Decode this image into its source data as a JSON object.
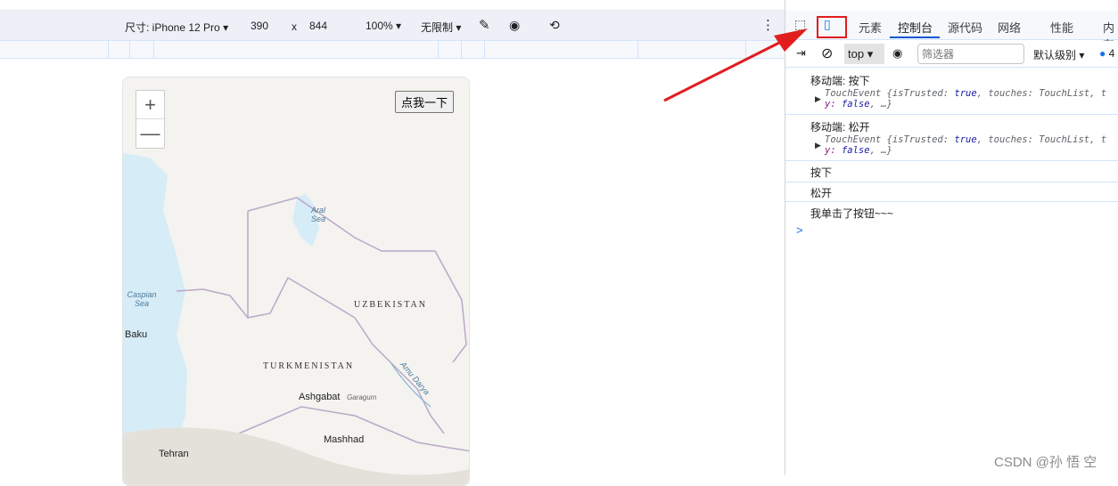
{
  "device_toolbar": {
    "dimensions_label": "尺寸: iPhone 12 Pro",
    "width": "390",
    "x": "x",
    "height": "844",
    "zoom": "100%",
    "throttle": "无限制"
  },
  "page": {
    "button_label": "点我一下",
    "zoom_in": "+",
    "zoom_out": "—",
    "map_labels": {
      "aral": "Aral Sea",
      "caspian": "Caspian Sea",
      "uzbekistan": "UZBEKISTAN",
      "turkmenistan": "TURKMENISTAN",
      "baku": "Baku",
      "ashgabat": "Ashgabat",
      "garagum": "Garagum",
      "mashhad": "Mashhad",
      "tehran": "Tehran",
      "amu": "Amu Darya"
    }
  },
  "devtools": {
    "tabs": [
      {
        "label": "元素"
      },
      {
        "label": "控制台",
        "active": true
      },
      {
        "label": "源代码"
      },
      {
        "label": "网络"
      },
      {
        "label": "性能"
      },
      {
        "label": "内存"
      }
    ],
    "context": "top",
    "filter_placeholder": "筛选器",
    "level": "默认级别",
    "issues_count": "4",
    "logs": [
      {
        "text": "移动端: 按下",
        "detail_a": "TouchEvent {isTrusted: ",
        "v1": "true",
        "detail_b": ", touches: TouchList, t",
        "detail_c": "y: ",
        "v2": "false",
        "detail_d": ", …}"
      },
      {
        "text": "移动端: 松开",
        "detail_a": "TouchEvent {isTrusted: ",
        "v1": "true",
        "detail_b": ", touches: TouchList, t",
        "detail_c": "y: ",
        "v2": "false",
        "detail_d": ", …}"
      },
      {
        "text": "按下"
      },
      {
        "text": "松开"
      },
      {
        "text": "我单击了按钮~~~"
      }
    ],
    "prompt": ">"
  },
  "watermark": "CSDN @孙 悟 空",
  "colors": {
    "accent": "#1a73e8",
    "highlight": "#e21d1d"
  }
}
